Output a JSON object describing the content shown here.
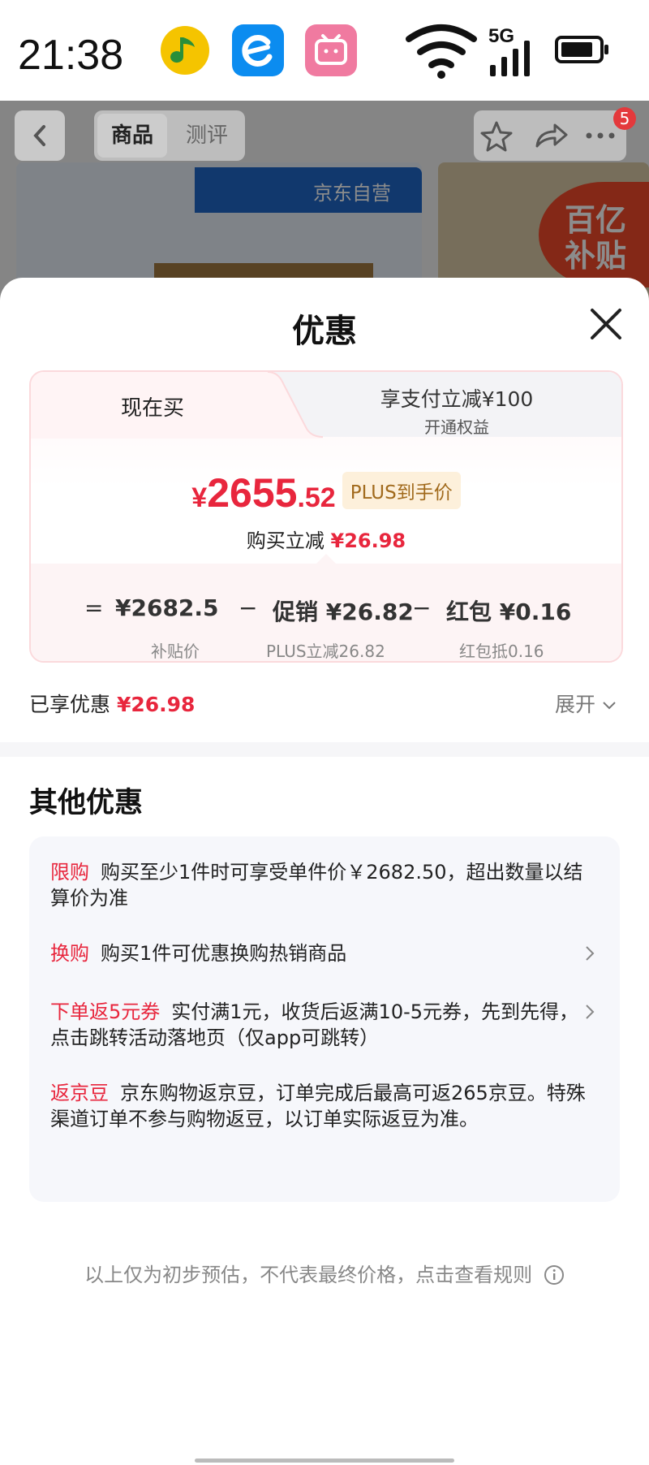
{
  "status_bar": {
    "time": "21:38",
    "network": "5G"
  },
  "product_nav": {
    "tabs": [
      "商品",
      "测评"
    ],
    "badge_count": "5",
    "brand_banner": "京东自营",
    "subsidy_label": [
      "百亿",
      "补贴"
    ]
  },
  "sheet": {
    "title": "优惠",
    "tab_now": "现在买",
    "tab_pay": "享支付立减¥100",
    "tab_pay_sub": "开通权益",
    "price_symbol": "¥",
    "price_main": "2655",
    "price_decimal": ".52",
    "plus_tag": "PLUS到手价",
    "reduce_label": "购买立减",
    "reduce_amount": "¥26.98",
    "breakdown": [
      {
        "op": "=",
        "value": "¥2682.5",
        "sub": "补贴价"
      },
      {
        "op": "−",
        "value": "促销 ¥26.82",
        "sub": "PLUS立减26.82"
      },
      {
        "op": "−",
        "value": "红包 ¥0.16",
        "sub": "红包抵0.16"
      }
    ],
    "enjoyed_label": "已享优惠",
    "enjoyed_amount": "¥26.98",
    "expand_label": "展开",
    "other_title": "其他优惠",
    "promos": [
      {
        "tag": "限购",
        "text": "购买至少1件时可享受单件价￥2682.50，超出数量以结算价为准"
      },
      {
        "tag": "换购",
        "text": "购买1件可优惠换购热销商品"
      },
      {
        "tag": "下单返5元券",
        "text": "实付满1元，收货后返满10-5元券，先到先得，点击跳转活动落地页（仅app可跳转）"
      },
      {
        "tag": "返京豆",
        "text": "京东购物返京豆，订单完成后最高可返265京豆。特殊渠道订单不参与购物返豆，以订单实际返豆为准。"
      }
    ],
    "disclaimer": "以上仅为初步预估，不代表最终价格，点击查看规则"
  },
  "colors": {
    "accent_red": "#e8263d",
    "plus_gold": "#a16a1c",
    "plus_bg": "#fdf0db"
  }
}
